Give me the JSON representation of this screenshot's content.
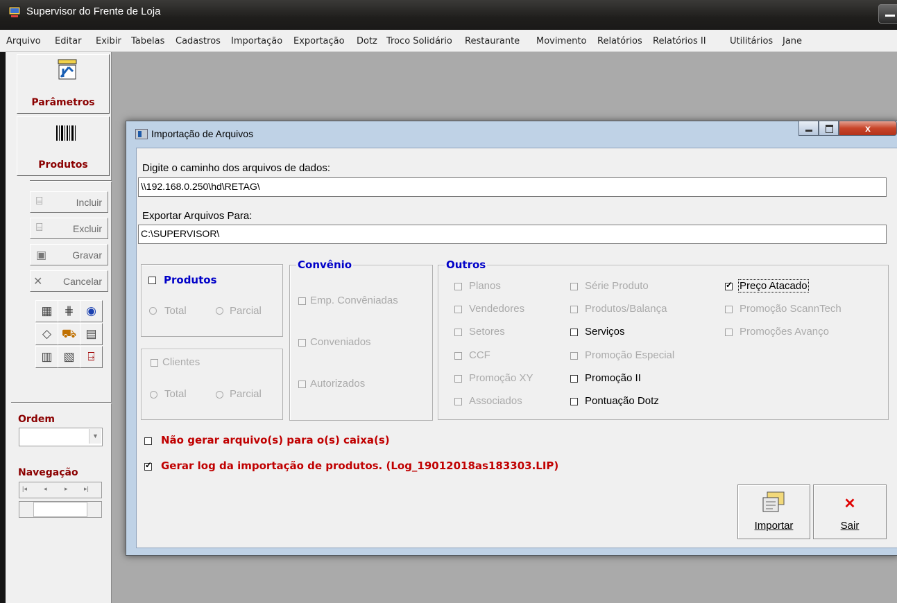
{
  "app": {
    "title": "Supervisor do Frente de Loja"
  },
  "menu": [
    "Arquivo",
    "Editar",
    "Exibir",
    "Tabelas",
    "Cadastros",
    "Importação",
    "Exportação",
    "Dotz",
    "Troco Solidário",
    "Restaurante",
    "Movimento",
    "Relatórios",
    "Relatórios II",
    "Utilitários",
    "Jane"
  ],
  "toolbar": {
    "parametros": "Parâmetros",
    "produtos": "Produtos",
    "incluir": "Incluir",
    "excluir": "Excluir",
    "gravar": "Gravar",
    "cancelar": "Cancelar",
    "ordem": "Ordem",
    "navegacao": "Navegação"
  },
  "dialog": {
    "title": "Importação de Arquivos",
    "path_label": "Digite o caminho dos arquivos de dados:",
    "path_value": "\\\\192.168.0.250\\hd\\RETAG\\",
    "export_label": "Exportar Arquivos Para:",
    "export_value": "C:\\SUPERVISOR\\",
    "produtos": {
      "label": "Produtos",
      "checked": false,
      "total": "Total",
      "parcial": "Parcial"
    },
    "clientes": {
      "label": "Clientes",
      "checked": false,
      "total": "Total",
      "parcial": "Parcial"
    },
    "convenio": {
      "title": "Convênio",
      "items": [
        "Emp. Convêniadas",
        "Conveniados",
        "Autorizados"
      ]
    },
    "outros": {
      "title": "Outros",
      "col1": [
        "Planos",
        "Vendedores",
        "Setores",
        "CCF",
        "Promoção XY",
        "Associados"
      ],
      "col2": [
        "Série Produto",
        "Produtos/Balança",
        "Serviços",
        "Promoção Especial",
        "Promoção II",
        "Pontuação Dotz"
      ],
      "col3": [
        "Preço Atacado",
        "Promoção ScannTech",
        "Promoções Avanço"
      ]
    },
    "nao_gerar": "Não gerar arquivo(s) para o(s) caixa(s)",
    "gerar_log": "Gerar log da importação de produtos. (Log_19012018as183303.LIP)",
    "importar": "Importar",
    "sair": "Sair"
  }
}
